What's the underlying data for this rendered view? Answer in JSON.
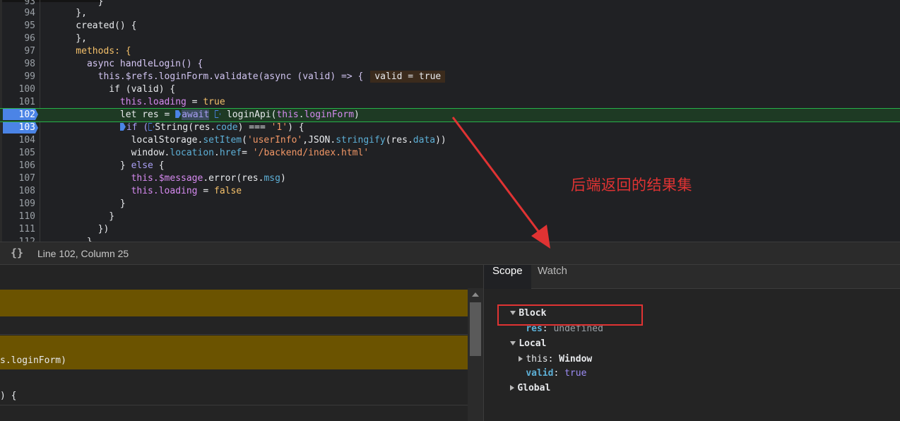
{
  "editor": {
    "lines": [
      {
        "num": "94",
        "code": "    },"
      },
      {
        "num": "95",
        "code": "    created() {"
      },
      {
        "num": "96",
        "code": "    },"
      },
      {
        "num": "97",
        "code": "    methods: {"
      },
      {
        "num": "98",
        "code": "      async handleLogin() {"
      },
      {
        "num": "99",
        "code_a": "        this.$refs.loginForm.validate(async (valid) => {",
        "inline_value": "valid = true"
      },
      {
        "num": "100",
        "code": "          if (valid) {"
      },
      {
        "num": "101",
        "code_a": "            this.",
        "code_b": "loading",
        "code_c": " = ",
        "code_d": "true"
      },
      {
        "num": "102",
        "code_a": "            let res = ",
        "code_b": "await",
        "code_c": " loginApi(",
        "code_d": "this",
        "code_e": ".",
        "code_f": "loginForm",
        "code_g": ")"
      },
      {
        "num": "103",
        "code_a": "            ",
        "code_b": "if (",
        "code_c": "String(res.",
        "code_d": "code",
        "code_e": ") === ",
        "code_f": "'1'",
        "code_g": ") {"
      },
      {
        "num": "104",
        "code_a": "              localStorage.",
        "code_b": "setItem",
        "code_c": "(",
        "code_d": "'userInfo'",
        "code_e": ",JSON.",
        "code_f": "stringify",
        "code_g": "(res.",
        "code_h": "data",
        "code_i": "))"
      },
      {
        "num": "105",
        "code_a": "              window.",
        "code_b": "location",
        "code_c": ".",
        "code_d": "href",
        "code_e": "= ",
        "code_f": "'/backend/index.html'"
      },
      {
        "num": "106",
        "code_a": "            } ",
        "code_b": "else",
        "code_c": " {"
      },
      {
        "num": "107",
        "code_a": "              this.",
        "code_b": "$message",
        "code_c": ".",
        "code_d": "error",
        "code_e": "(res.",
        "code_f": "msg",
        "code_g": ")"
      },
      {
        "num": "108",
        "code_a": "              this.",
        "code_b": "loading",
        "code_c": " = ",
        "code_d": "false"
      },
      {
        "num": "109",
        "code": "            }"
      },
      {
        "num": "110",
        "code": "          }"
      },
      {
        "num": "111",
        "code": "        })"
      }
    ]
  },
  "annotation": {
    "text": "后端返回的结果集"
  },
  "statusbar": {
    "braces": "{}",
    "position": "Line 102, Column 25"
  },
  "console": {
    "frag1": "s.loginForm)",
    "frag2": ") {"
  },
  "scope": {
    "tabs": {
      "scope": "Scope",
      "watch": "Watch"
    },
    "block_label": "Block",
    "res_name": "res",
    "res_value": "undefined",
    "local_label": "Local",
    "this_name": "this",
    "this_value": "Window",
    "valid_name": "valid",
    "valid_value": "true",
    "global_label": "Global",
    "sep": ": "
  },
  "colors": {
    "accent": "#4b84e6",
    "paused_line": "#27b14a",
    "annotation": "#e03333",
    "highlight_bar": "#6b5300"
  }
}
